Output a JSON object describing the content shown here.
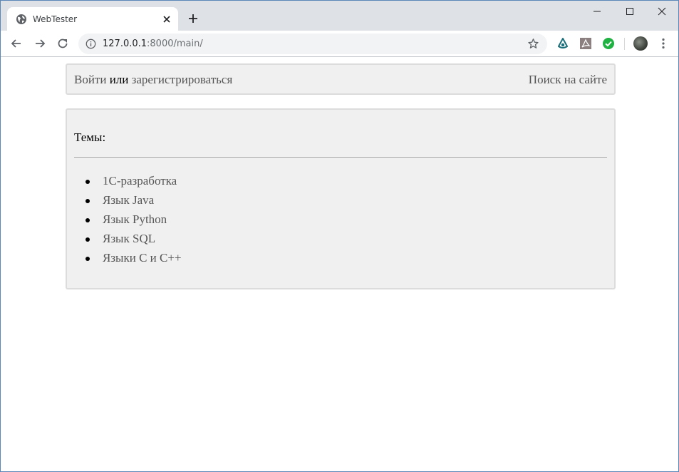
{
  "browser": {
    "tab_title": "WebTester",
    "url_host": "127.0.0.1",
    "url_rest": ":8000/main/",
    "accent": "#1a73e8"
  },
  "header": {
    "login_label": "Войти",
    "or_label": "или",
    "register_label": "зарегистрироваться",
    "search_label": "Поиск на сайте"
  },
  "topics": {
    "heading": "Темы:",
    "items": [
      {
        "label": "1С-разработка"
      },
      {
        "label": "Язык Java"
      },
      {
        "label": "Язык Python"
      },
      {
        "label": "Язык SQL"
      },
      {
        "label": "Языки C и C++"
      }
    ]
  },
  "colors": {
    "panel_bg": "#f0f0f0",
    "panel_border": "#dcdcdc",
    "link_text": "#555555"
  },
  "icons": {
    "favicon": "globe-icon",
    "tab_close": "close-icon",
    "new_tab": "plus-icon",
    "back": "arrow-left-icon",
    "forward": "arrow-right-icon",
    "reload": "reload-icon",
    "site_info": "info-icon",
    "bookmark": "star-icon",
    "ext1": "drop-extension-icon",
    "ext2": "pdf-extension-icon",
    "ext3": "check-extension-icon",
    "menu": "kebab-menu-icon"
  }
}
